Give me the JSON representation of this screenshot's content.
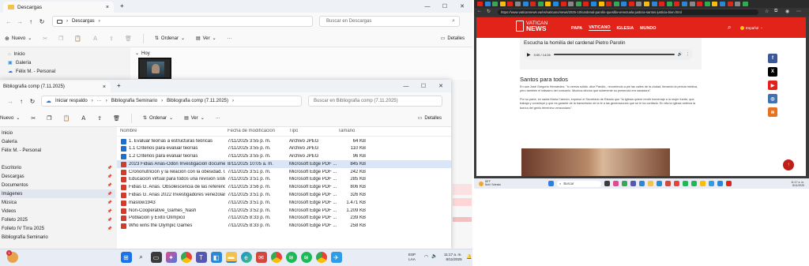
{
  "win1": {
    "tab_title": "Descargas",
    "breadcrumb": "Descargas",
    "search_placeholder": "Buscar en Descargas",
    "cmd": {
      "new": "Nuevo",
      "sort": "Ordenar",
      "view": "Ver",
      "details": "Detalles"
    },
    "sidebar": [
      {
        "label": "Inicio",
        "icon": "home-icon"
      },
      {
        "label": "Galería",
        "icon": "gallery-icon"
      },
      {
        "label": "Félix M. - Personal",
        "icon": "cloud-icon"
      }
    ],
    "group_label": "Hoy"
  },
  "win2": {
    "tab_title": "Bibliografia comp (7.11.2025)",
    "breadcrumb": [
      "Iniciar respaldo",
      "Bibliografia Seminario",
      "Bibliografia comp (7.11.2025)"
    ],
    "search_placeholder": "Buscar en Bibliografia comp (7.11.2025)",
    "cmd": {
      "new": "Nuevo",
      "sort": "Ordenar",
      "view": "Ver",
      "details": "Detalles"
    },
    "sidebar": [
      {
        "label": "Inicio",
        "pinned": false
      },
      {
        "label": "Galería",
        "pinned": false
      },
      {
        "label": "Félix M. - Personal",
        "pinned": false
      },
      {
        "label": "",
        "pinned": false
      },
      {
        "label": "Escritorio",
        "pinned": true
      },
      {
        "label": "Descargas",
        "pinned": true
      },
      {
        "label": "Documentos",
        "pinned": true
      },
      {
        "label": "Imágenes",
        "pinned": true,
        "selected": true
      },
      {
        "label": "Música",
        "pinned": true
      },
      {
        "label": "Videos",
        "pinned": true
      },
      {
        "label": "Folleto 2025",
        "pinned": true
      },
      {
        "label": "Folleto IV Tirra 2025",
        "pinned": true
      },
      {
        "label": "Bibliografía Seminario",
        "pinned": false
      }
    ],
    "columns": {
      "name": "Nombre",
      "date": "Fecha de modificación",
      "type": "Tipo",
      "size": "Tamaño"
    },
    "files": [
      {
        "name": "1. Evaluar teorías a estructuras teóricas",
        "date": "7/11/2025 3:55 p. m.",
        "type": "Archivo JPEG",
        "size": "64 KB",
        "kind": "img"
      },
      {
        "name": "1.1 Criterios para evaluar teorías",
        "date": "7/11/2025 3:55 p. m.",
        "type": "Archivo JPEG",
        "size": "110 KB",
        "kind": "img"
      },
      {
        "name": "1.2 Criterios para evaluar teorías",
        "date": "7/11/2025 3:55 p. m.",
        "type": "Archivo JPEG",
        "size": "96 KB",
        "kind": "img"
      },
      {
        "name": "2023 Fidias Arias-Odón Investigación documen...",
        "date": "8/11/2025 10:05 a. m.",
        "type": "Microsoft Edge PDF ...",
        "size": "845 KB",
        "kind": "pdf",
        "selected": true
      },
      {
        "name": "Crononutrición y la relación con la obesidad. U...",
        "date": "7/11/2025 3:51 p. m.",
        "type": "Microsoft Edge PDF ...",
        "size": "242 KB",
        "kind": "pdf"
      },
      {
        "name": "Educación virtual para todos una revisión siste...",
        "date": "7/11/2025 3:51 p. m.",
        "type": "Microsoft Edge PDF ...",
        "size": "285 KB",
        "kind": "pdf"
      },
      {
        "name": "Fidias G. Arias. Obsolescencia de las referencias ...",
        "date": "7/11/2025 3:56 p. m.",
        "type": "Microsoft Edge PDF ...",
        "size": "806 KB",
        "kind": "pdf"
      },
      {
        "name": "Fidias G. Arias 2022 Investigadores venezolanas...",
        "date": "7/11/2025 3:51 p. m.",
        "type": "Microsoft Edge PDF ...",
        "size": "326 KB",
        "kind": "pdf"
      },
      {
        "name": "maslow1943",
        "date": "7/11/2025 3:51 p. m.",
        "type": "Microsoft Edge PDF ...",
        "size": "1.471 KB",
        "kind": "pdf"
      },
      {
        "name": "Non-Cooperative_Games_Nash",
        "date": "7/11/2025 3:52 p. m.",
        "type": "Microsoft Edge PDF ...",
        "size": "1.209 KB",
        "kind": "pdf"
      },
      {
        "name": "Población y Éxito Olímpico",
        "date": "7/11/2025 8:33 p. m.",
        "type": "Microsoft Edge PDF ...",
        "size": "239 KB",
        "kind": "pdf"
      },
      {
        "name": "Who wins the Olympic Games",
        "date": "7/11/2025 8:33 p. m.",
        "type": "Microsoft Edge PDF ...",
        "size": "258 KB",
        "kind": "pdf"
      }
    ]
  },
  "browser": {
    "url": "https://www.vaticannews.va/es/vaticano/news/2025-10/cardenal-parolin-quesilla-venezuela-justicia-santos-justicia-bien.html",
    "logo_line1": "VATICAN",
    "logo_line2": "NEWS",
    "nav": [
      "PAPA",
      "VATICANO",
      "IGLESIA",
      "MUNDO"
    ],
    "language": "Español",
    "audio_title": "Escucha la homilía del cardenal Pietro Parolin",
    "audio_time": "0:00 / 14:26",
    "section_title": "Santos para todos",
    "para1": "En san José Gregorio Hernández, \"lo vemos sólido -dice Parolin-, recorriendo a pie las calles de la ciudad, llevando la pericia médica, pero también el bálsamo del consuelo. Muchos decían que solamente su presencia era sanadora\".",
    "para2": "Por su parte, en santa María Carmen, expresó el Secretario de Estado que \"la Iglesia quiere rendir homenaje a la mujer fuerte, que trabaja y construye y que es garante de la transmisión de la fe a las generaciones que se le ha confiado. En ella la Iglesia celebra la fuerza del genio femenino venezolano\".",
    "social": [
      "facebook-icon",
      "x-icon",
      "youtube-icon",
      "instagram-icon",
      "rss-icon"
    ],
    "taskbar_weather": "88°F",
    "taskbar_weather_sub": "Nubl. Soleado",
    "taskbar_search": "Buscar",
    "taskbar_time": "11:17 a. m.",
    "taskbar_date": "8/11/2025"
  },
  "taskbar": {
    "search_placeholder": "Buscar",
    "lang_line1": "ESP",
    "lang_line2": "LAA",
    "time": "11:17 a. m.",
    "date": "8/11/2025",
    "badge": "1"
  }
}
